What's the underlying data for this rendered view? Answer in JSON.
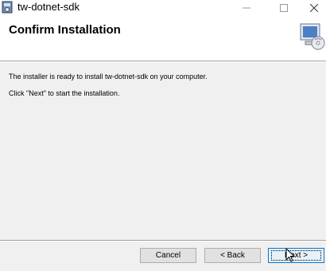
{
  "window": {
    "title": "tw-dotnet-sdk",
    "minimize_glyph": "—",
    "maximize_glyph": "☐",
    "close_glyph": "✕"
  },
  "header": {
    "title": "Confirm Installation",
    "icon": "computer-cd-icon"
  },
  "body": {
    "line1": "The installer is ready to install tw-dotnet-sdk on your computer.",
    "line2": "Click \"Next\" to start the installation."
  },
  "buttons": {
    "cancel": "Cancel",
    "back": "< Back",
    "next": "Next >"
  },
  "colors": {
    "accent": "#0078d7",
    "window_bg": "#f0f0f0",
    "header_bg": "#ffffff"
  }
}
